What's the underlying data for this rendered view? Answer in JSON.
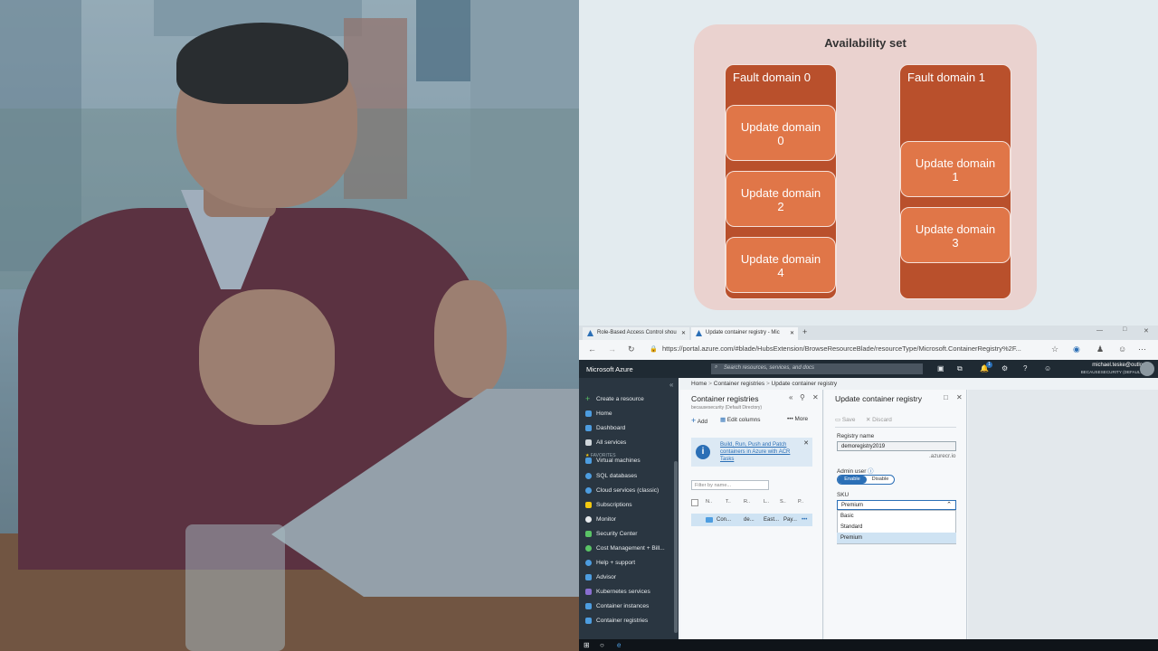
{
  "diagram": {
    "title": "Availability set",
    "fault_domains": [
      {
        "label": "Fault domain 0",
        "update_domains": [
          "Update domain 0",
          "Update domain 2",
          "Update domain 4"
        ]
      },
      {
        "label": "Fault domain 1",
        "update_domains": [
          "Update domain 1",
          "Update domain 3"
        ]
      }
    ],
    "colors": {
      "set_bg": "#ead2cf",
      "fault_domain": "#b9502c",
      "update_domain": "#e07648"
    }
  },
  "browser": {
    "tabs": [
      {
        "label": "Role-Based Access Control shou"
      },
      {
        "label": "Update container registry - Mic"
      }
    ],
    "new_tab": "+",
    "window_controls": [
      "—",
      "□",
      "✕"
    ],
    "url": "https://portal.azure.com/#blade/HubsExtension/BrowseResourceBlade/resourceType/Microsoft.ContainerRegistry%2F..."
  },
  "azure": {
    "brand": "Microsoft Azure",
    "search_placeholder": "Search resources, services, and docs",
    "notification_count": "1",
    "account_email": "michael.teske@outlo...",
    "account_tenant": "BECAUSESECURITY (DEFAULT ...",
    "nav": {
      "collapse": "«",
      "top_items": [
        "Create a resource",
        "Home",
        "Dashboard",
        "All services"
      ],
      "favorites_header": "FAVORITES",
      "favorites": [
        "Virtual machines",
        "SQL databases",
        "Cloud services (classic)",
        "Subscriptions",
        "Monitor",
        "Security Center",
        "Cost Management + Bill...",
        "Help + support",
        "Advisor",
        "Kubernetes services",
        "Container instances",
        "Container registries"
      ]
    },
    "breadcrumb": [
      "Home",
      ">",
      "Container registries",
      ">",
      "Update container registry"
    ],
    "registries_blade": {
      "title": "Container registries",
      "subtitle": "becausesecurity (Default Directory)",
      "toolbar": {
        "add": "Add",
        "edit_columns": "Edit columns",
        "more": "More"
      },
      "info_link": "Build, Run, Push and Patch containers in Azure with ACR Tasks",
      "filter_placeholder": "Filter by name...",
      "columns": [
        "N..",
        "T..",
        "R..",
        "L..",
        "S..",
        "P.."
      ],
      "rows": [
        {
          "name": "Con...",
          "type": "de...",
          "location": "East...",
          "sku": "Pay..."
        }
      ]
    },
    "update_blade": {
      "title": "Update container registry",
      "save": "Save",
      "discard": "Discard",
      "registry_name_label": "Registry name",
      "registry_name_value": "demoregistry2019",
      "domain_suffix": ".azurecr.io",
      "admin_user_label": "Admin user",
      "admin_enable": "Enable",
      "admin_disable": "Disable",
      "sku_label": "SKU",
      "sku_selected": "Premium",
      "sku_options": [
        "Basic",
        "Standard",
        "Premium"
      ]
    }
  }
}
